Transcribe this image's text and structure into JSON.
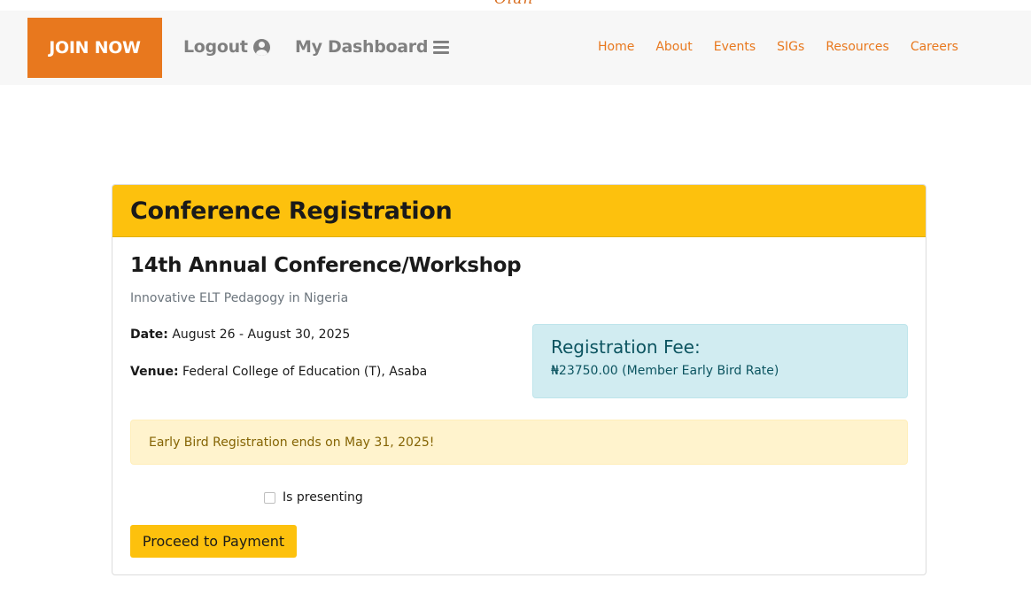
{
  "logo": {
    "fragment_text": "Olan"
  },
  "navbar": {
    "join_label": "JOIN NOW",
    "logout_label": "Logout",
    "dashboard_label": "My Dashboard",
    "menu": [
      "Home",
      "About",
      "Events",
      "SIGs",
      "Resources",
      "Careers"
    ]
  },
  "card": {
    "header_title": "Conference Registration",
    "event_title": "14th Annual Conference/Workshop",
    "event_subtitle": "Innovative ELT Pedagogy in Nigeria",
    "date_label": "Date:",
    "date_value": "August 26 - August 30, 2025",
    "venue_label": "Venue:",
    "venue_value": "Federal College of Education (T), Asaba",
    "fee_title": "Registration Fee:",
    "fee_value": "₦23750.00 (Member Early Bird Rate)",
    "alert_text": "Early Bird Registration ends on May 31, 2025!",
    "checkbox_label": "Is presenting",
    "checkbox_checked": false,
    "pay_label": "Proceed to Payment"
  },
  "colors": {
    "brand_orange": "#e8781e",
    "header_yellow": "#fdc10d",
    "info_bg": "#d1ecf1",
    "info_text": "#0c5460",
    "warning_bg": "#fff3cd",
    "warning_text": "#856404"
  }
}
